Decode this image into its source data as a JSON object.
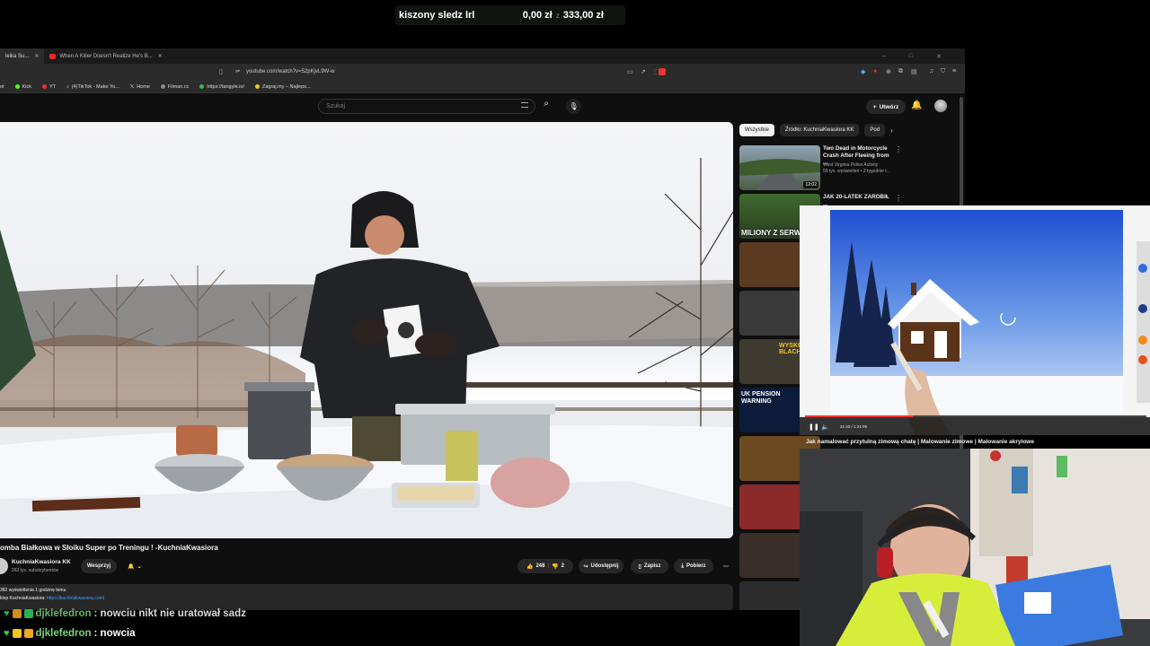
{
  "goal": {
    "label": "kiszony sledz lrl",
    "current": "0,00 zł",
    "separator": "z",
    "target": "333,00 zł",
    "accent": "#1f3a1f"
  },
  "browser": {
    "tabs": [
      {
        "label": "leika Su...",
        "active": true
      },
      {
        "label": "When A Killer Doesn't Realize He's B...",
        "active": false
      }
    ],
    "url": "youtube.com/watch?v=52pKjvL9W-w",
    "bookmarks": [
      "ot",
      "Kick",
      "YT",
      "(4)TikTok - Make Yo...",
      "Home",
      "Filman.cc",
      "https://tangyle.io/",
      "Zagraj.my – Najleps..."
    ],
    "window_controls": [
      "–",
      "□",
      "✕"
    ]
  },
  "youtube": {
    "search_placeholder": "Szukaj",
    "create_label": "Utwórz",
    "video": {
      "title": "omba Białkowa w Słoiku Super po Treningu ! -KuchniaKwasiora",
      "channel": "KuchniaKwasiora KK",
      "subs": "263 tys. subskrybentów",
      "support_label": "Wesprzyj",
      "likes": "248",
      "dislikes": "2",
      "share_label": "Udostępnij",
      "save_label": "Zapisz",
      "download_label": "Pobierz",
      "views_line": "382 wyświetlenia  1 godzinę temu",
      "shop_prefix": "klep KuchniaKwasiora: ",
      "shop_link": "https://kuchniakwasiora.com/"
    },
    "chips": [
      {
        "label": "Wszystkie",
        "active": true
      },
      {
        "label": "Źródło: KuchniaKwasiora KK",
        "active": false
      },
      {
        "label": "Pod",
        "active": false
      }
    ],
    "recs": [
      {
        "title": "Two Dead in Motorcycle Crash After Fleeing from ...",
        "channel": "West Virginia Police Activity",
        "meta": "59 tys. wyświetleń • 2 tygodnie t...",
        "duration": "12:02"
      },
      {
        "title": "JAK 20-LATEK ZAROBIŁ ...",
        "thumb_text": "MILIONY Z SERWE"
      },
      {
        "thumb_text": ""
      },
      {
        "thumb_text": ""
      },
      {
        "thumb_text": "WYSKOCZ Z BLACH"
      },
      {
        "thumb_text": "UK PENSION WARNING"
      },
      {
        "thumb_text": ""
      },
      {
        "thumb_text": ""
      },
      {
        "thumb_text": ""
      },
      {
        "thumb_text": ""
      }
    ]
  },
  "overlay": {
    "title": "Jak namalować przytulną zimową chatę | Malowanie zimowe | Malowanie akrylowe",
    "time": "21:43 / 1:21:09"
  },
  "chat": [
    {
      "user": "djklefedron",
      "message": ": nowciu nikt nie uratował sadz"
    },
    {
      "user": "djklefedron",
      "message": ": nowcia"
    }
  ]
}
